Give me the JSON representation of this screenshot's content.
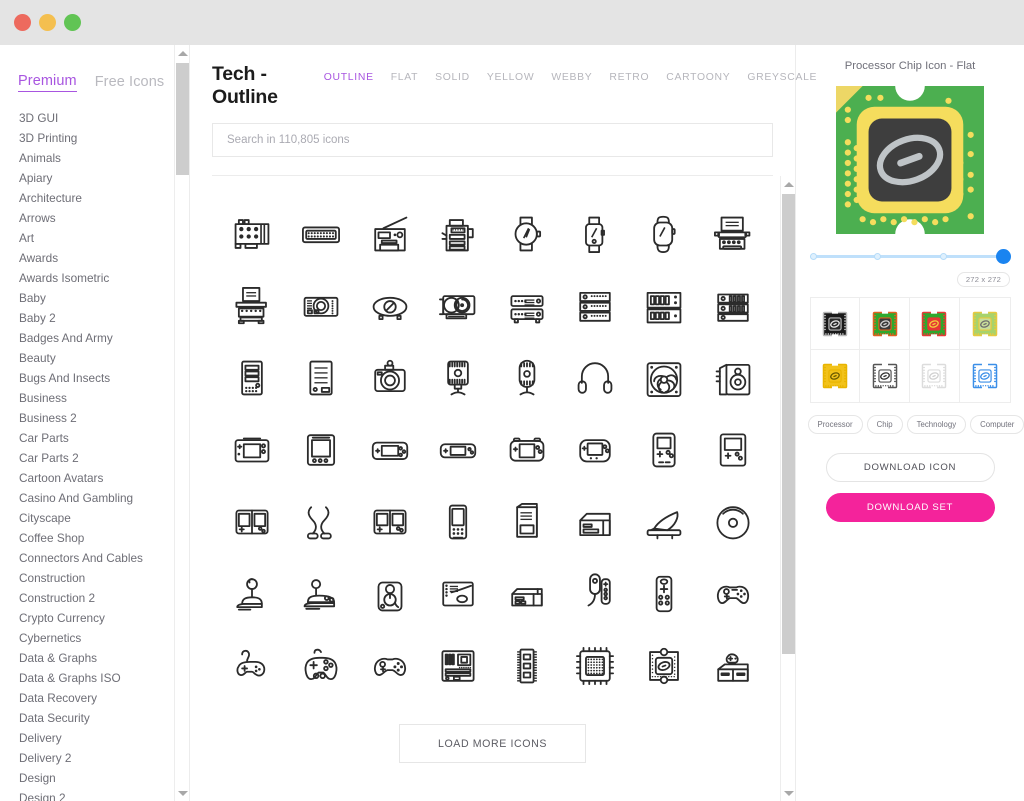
{
  "window": {
    "traffic_lights": [
      {
        "name": "close",
        "color": "#ED6A5E"
      },
      {
        "name": "minimize",
        "color": "#F4BF4F"
      },
      {
        "name": "zoom",
        "color": "#61C454"
      }
    ],
    "titlebar_color": "#E4E4E4"
  },
  "sidebar": {
    "tabs": [
      {
        "label": "Premium",
        "active": true
      },
      {
        "label": "Free Icons",
        "active": false
      }
    ],
    "categories": [
      "3D GUI",
      "3D Printing",
      "Animals",
      "Apiary",
      "Architecture",
      "Arrows",
      "Art",
      "Awards",
      "Awards Isometric",
      "Baby",
      "Baby 2",
      "Badges And Army",
      "Beauty",
      "Bugs And Insects",
      "Business",
      "Business 2",
      "Car Parts",
      "Car Parts 2",
      "Cartoon Avatars",
      "Casino And Gambling",
      "Cityscape",
      "Coffee Shop",
      "Connectors And Cables",
      "Construction",
      "Construction 2",
      "Crypto Currency",
      "Cybernetics",
      "Data & Graphs",
      "Data & Graphs ISO",
      "Data Recovery",
      "Data Security",
      "Delivery",
      "Delivery 2",
      "Design",
      "Design 2"
    ],
    "accent_color": "#A855E0"
  },
  "main": {
    "pack_title": "Tech - Outline",
    "style_tabs": [
      {
        "label": "OUTLINE",
        "active": true
      },
      {
        "label": "FLAT",
        "active": false
      },
      {
        "label": "SOLID",
        "active": false
      },
      {
        "label": "YELLOW",
        "active": false
      },
      {
        "label": "WEBBY",
        "active": false
      },
      {
        "label": "RETRO",
        "active": false
      },
      {
        "label": "CARTOONY",
        "active": false
      },
      {
        "label": "GREYSCALE",
        "active": false
      }
    ],
    "search": {
      "value": "",
      "placeholder": "Search in 110,805 icons"
    },
    "load_more_label": "LOAD MORE ICONS",
    "icons": [
      "expansion-card-icon",
      "keyboard-icon",
      "radio-icon",
      "copier-icon",
      "analog-watch-icon",
      "smartwatch-icon",
      "apple-watch-icon",
      "typewriter-icon",
      "typewriter-2-icon",
      "projector-front-icon",
      "projector-side-icon",
      "graphics-card-icon",
      "server-stack-icon",
      "rack-server-icon",
      "blade-server-icon",
      "server-unit-icon",
      "desktop-tower-icon",
      "pc-case-icon",
      "camera-icon",
      "studio-microphone-icon",
      "condenser-mic-icon",
      "headphones-icon",
      "case-fan-icon",
      "speaker-pair-icon",
      "handheld-console-icon",
      "game-tablet-icon",
      "psp-icon",
      "handheld-slim-icon",
      "gameboy-advance-icon",
      "handheld-round-icon",
      "gameboy-icon",
      "handheld-dpad-icon",
      "nintendo-ds-icon",
      "controller-cable-icon",
      "nintendo-ds-2-icon",
      "retro-handheld-icon",
      "game-cartridge-icon",
      "console-slim-icon",
      "gramophone-icon",
      "disc-icon",
      "joystick-icon",
      "arcade-joystick-icon",
      "arcade-stick-icon",
      "motherboard-flat-icon",
      "vcr-icon",
      "wii-nunchuk-icon",
      "wii-remote-icon",
      "xbox-controller-icon",
      "wired-gamepad-icon",
      "dual-gamepad-icon",
      "xbox-pad-icon",
      "motherboard-icon",
      "ram-stick-icon",
      "cpu-socket-icon",
      "processor-chip-icon",
      "game-console-icon"
    ]
  },
  "preview": {
    "title": "Processor Chip Icon - Flat",
    "size_badge": "272 x 272",
    "slider": {
      "stops": 4,
      "value": 4
    },
    "chip_colors": {
      "board": "#4CAF50",
      "ring": "#F5DD5D",
      "die": "#3E3E3E",
      "logo": "#BFC4C7",
      "corner": "#EDD766"
    },
    "variants": [
      {
        "name": "variant-black",
        "board": "#1A1A1A",
        "ring": "#B8B8B8",
        "die": "#2A2A2A",
        "logo": "#E8E8E8"
      },
      {
        "name": "variant-green",
        "board": "#2EA92E",
        "ring": "#E06020",
        "die": "#3A3A3A",
        "logo": "#D6D6D6"
      },
      {
        "name": "variant-red",
        "board": "#2EA92E",
        "ring": "#E53935",
        "die": "#E53935",
        "logo": "#F2D33C"
      },
      {
        "name": "variant-lightgreen",
        "board": "#A7D36C",
        "ring": "#E6C93F",
        "die": "#C8DE9A",
        "logo": "#6E6E6E"
      },
      {
        "name": "variant-yellow",
        "board": "#F2C21A",
        "ring": "#E8B400",
        "die": "#F2C21A",
        "logo": "#6B5A00"
      },
      {
        "name": "variant-outline",
        "board": "#FFFFFF",
        "ring": "#555555",
        "die": "#FFFFFF",
        "logo": "#333333"
      },
      {
        "name": "variant-greyscale",
        "board": "#FFFFFF",
        "ring": "#DCDCDC",
        "die": "#FFFFFF",
        "logo": "#D0D0D0"
      },
      {
        "name": "variant-blue",
        "board": "#FFFFFF",
        "ring": "#3B8FE8",
        "die": "#FFFFFF",
        "logo": "#3B8FE8"
      }
    ],
    "tags": [
      "Processor",
      "Chip",
      "Technology",
      "Computer"
    ],
    "download_icon_label": "DOWNLOAD ICON",
    "download_set_label": "DOWNLOAD SET",
    "download_set_color": "#F4239B"
  }
}
